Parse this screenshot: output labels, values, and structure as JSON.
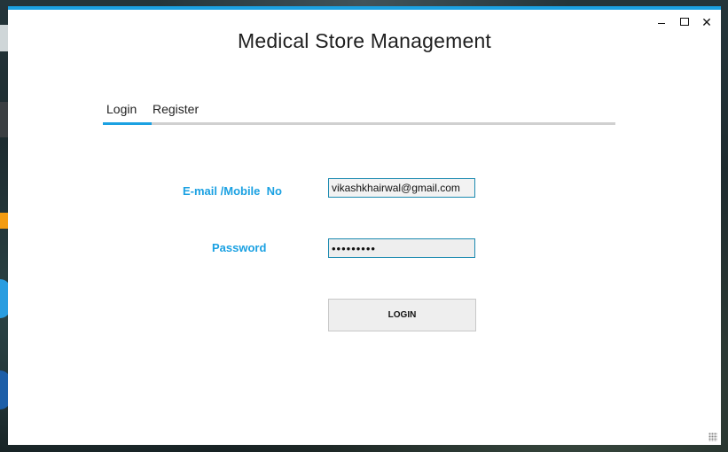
{
  "window": {
    "title": "Medical Store Management",
    "controls": {
      "minimize": "minimize",
      "maximize": "maximize",
      "close": "✕"
    }
  },
  "tabs": [
    {
      "label": "Login",
      "active": true
    },
    {
      "label": "Register",
      "active": false
    }
  ],
  "form": {
    "email_label": "E-mail /Mobile  No",
    "email_value": "vikashkhairwal@gmail.com",
    "password_label": "Password",
    "password_value": "•••••••••",
    "login_button": "LOGIN"
  },
  "colors": {
    "accent": "#1ba1e2",
    "field_border": "#1b8ab0",
    "field_background": "#eeeeee"
  }
}
